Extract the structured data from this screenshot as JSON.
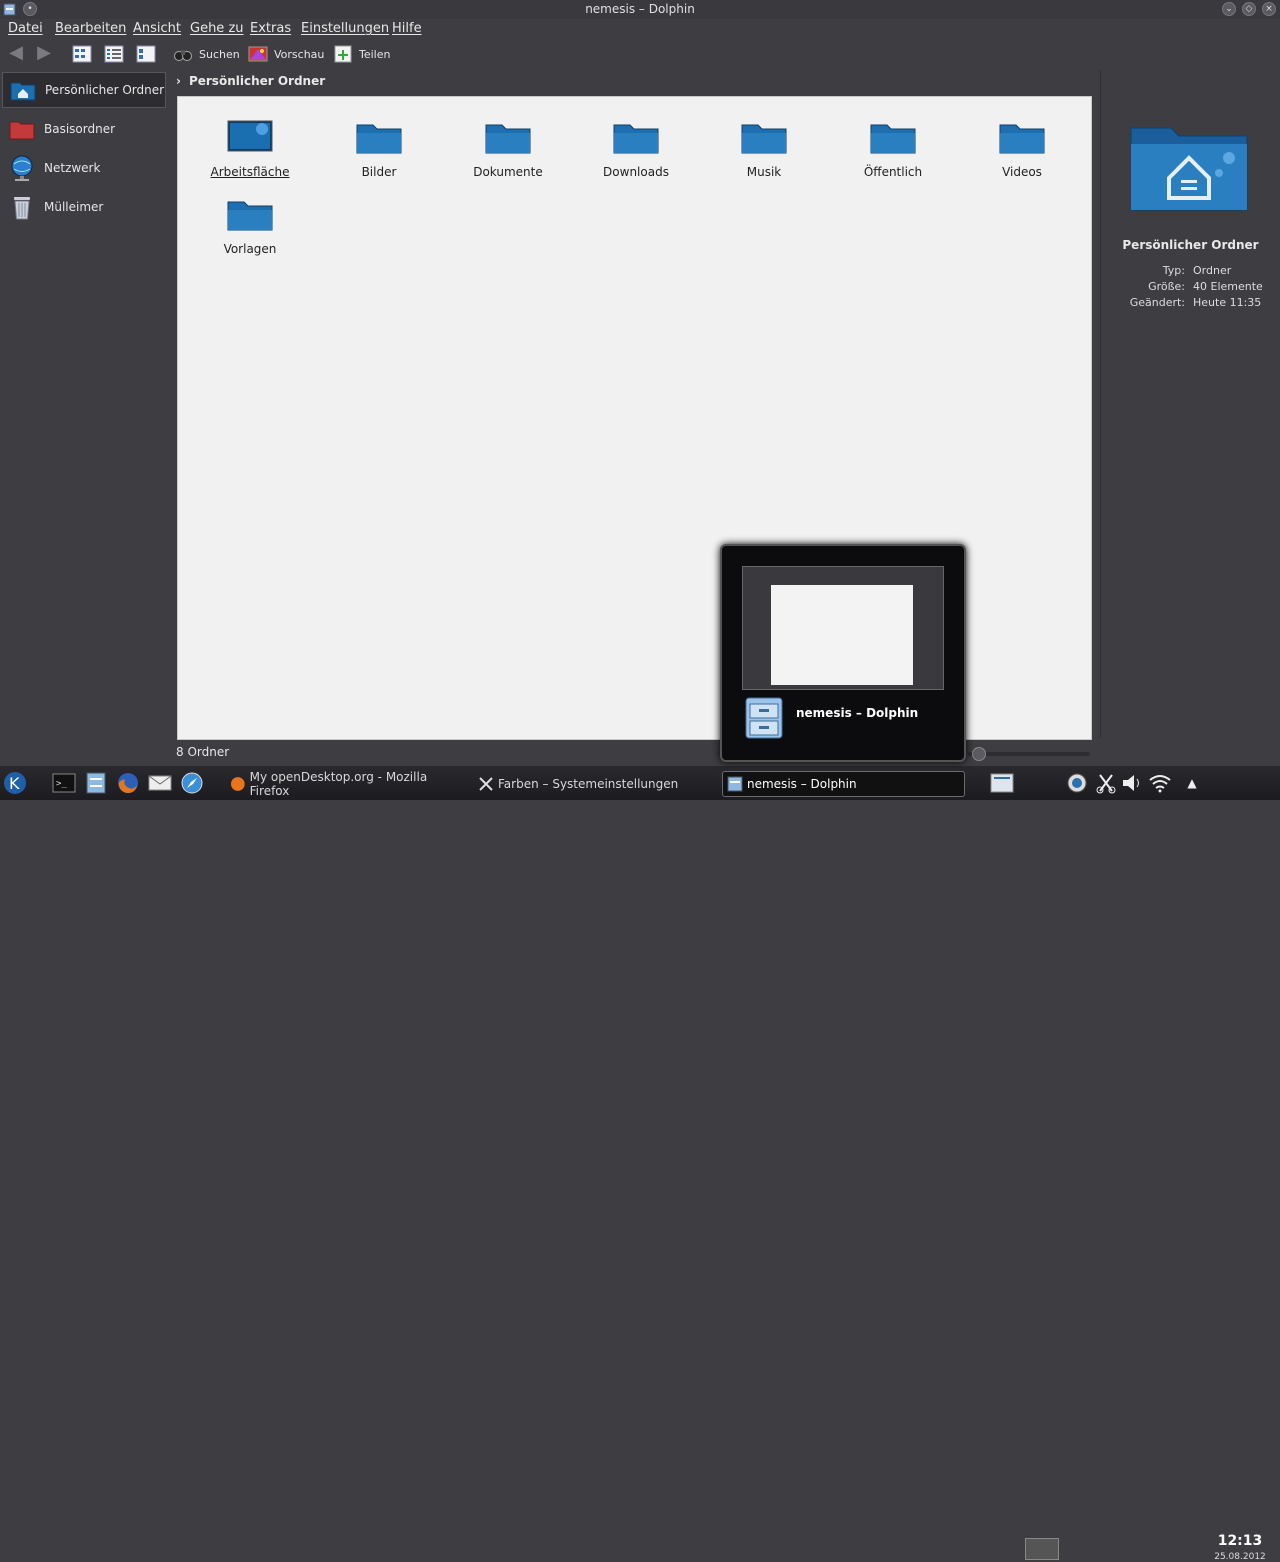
{
  "window": {
    "title": "nemesis – Dolphin"
  },
  "menu": [
    "Datei",
    "Bearbeiten",
    "Ansicht",
    "Gehe zu",
    "Extras",
    "Einstellungen",
    "Hilfe"
  ],
  "toolbar": {
    "search": "Suchen",
    "preview": "Vorschau",
    "share": "Teilen"
  },
  "places": [
    {
      "label": "Persönlicher Ordner",
      "icon": "home-folder-icon"
    },
    {
      "label": "Basisordner",
      "icon": "root-folder-icon"
    },
    {
      "label": "Netzwerk",
      "icon": "network-globe-icon"
    },
    {
      "label": "Mülleimer",
      "icon": "trash-icon"
    }
  ],
  "breadcrumb": "Persönlicher Ordner",
  "files": [
    {
      "label": "Arbeitsfläche",
      "icon": "desktop-icon"
    },
    {
      "label": "Bilder",
      "icon": "folder-icon"
    },
    {
      "label": "Dokumente",
      "icon": "folder-icon"
    },
    {
      "label": "Downloads",
      "icon": "folder-icon"
    },
    {
      "label": "Musik",
      "icon": "folder-icon"
    },
    {
      "label": "Öffentlich",
      "icon": "folder-icon"
    },
    {
      "label": "Videos",
      "icon": "folder-icon"
    },
    {
      "label": "Vorlagen",
      "icon": "folder-icon"
    }
  ],
  "info": {
    "name": "Persönlicher Ordner",
    "rows": [
      {
        "k": "Typ:",
        "v": "Ordner"
      },
      {
        "k": "Größe:",
        "v": "40 Elemente"
      },
      {
        "k": "Geändert:",
        "v": "Heute 11:35"
      }
    ]
  },
  "status": "8 Ordner",
  "preview": {
    "label": "nemesis – Dolphin"
  },
  "taskbar": {
    "tasks": [
      {
        "label": "My openDesktop.org - Mozilla Firefox"
      },
      {
        "label": "Farben – Systemeinstellungen"
      },
      {
        "label": "nemesis – Dolphin"
      }
    ],
    "clock": "12:13",
    "date": "25.08.2012"
  },
  "colors": {
    "accent": "#1e6fb0",
    "folder": "#2a7fc0",
    "view_bg": "#f1f1f1",
    "chrome": "#3e3e42"
  }
}
